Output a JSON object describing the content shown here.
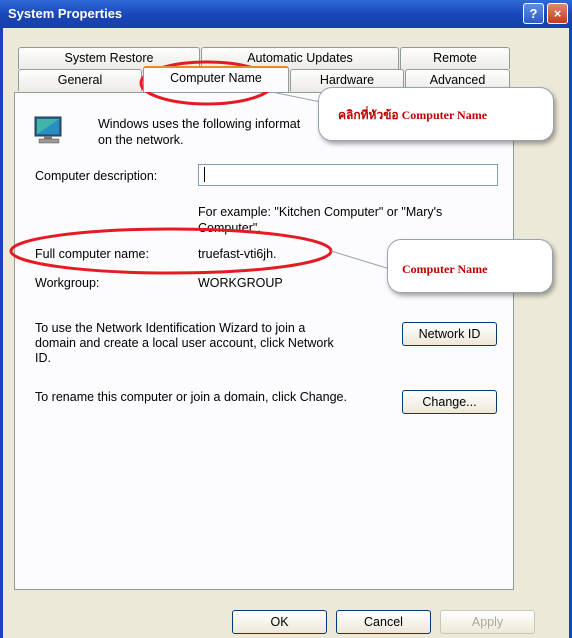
{
  "window": {
    "title": "System Properties",
    "help_button": "?",
    "close_button": "×"
  },
  "tabs_row1": [
    "System Restore",
    "Automatic Updates",
    "Remote"
  ],
  "tabs_row2": [
    "General",
    "Computer Name",
    "Hardware",
    "Advanced"
  ],
  "active_tab": "Computer Name",
  "panel": {
    "intro_line1": "Windows uses the following informat",
    "intro_line2": "on the network.",
    "description_label": "Computer description:",
    "description_value": "",
    "example_line1": "For example: \"Kitchen Computer\" or \"Mary's",
    "example_line2": "Computer\".",
    "full_name_label": "Full computer name:",
    "full_name_value": "truefast-vti6jh.",
    "workgroup_label": "Workgroup:",
    "workgroup_value": "WORKGROUP",
    "network_text_line1": "To use the Network Identification Wizard to join a",
    "network_text_line2": "domain and create a local user account, click Network",
    "network_text_line3": "ID.",
    "network_id_button": "Network ID",
    "rename_text": "To rename this computer or join a domain, click Change.",
    "change_button": "Change..."
  },
  "footer": {
    "ok_button": "OK",
    "cancel_button": "Cancel",
    "apply_button": "Apply"
  },
  "annotations": {
    "callout1_text": "คลิกที่หัวข้อ Computer Name",
    "callout2_text": "Computer Name",
    "highlight_color": "#e31b23"
  }
}
